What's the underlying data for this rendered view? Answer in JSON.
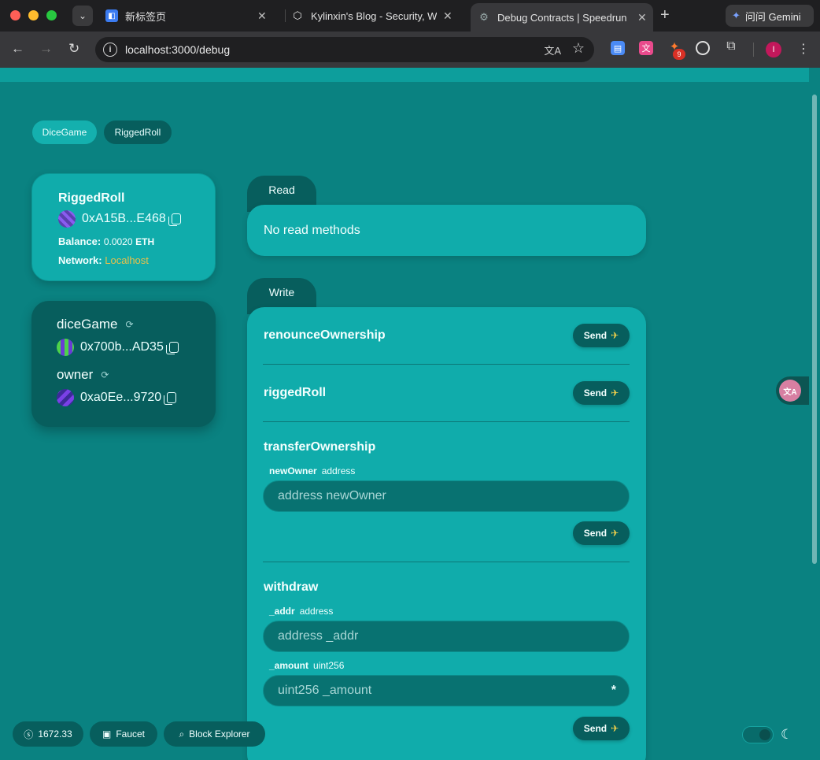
{
  "browser": {
    "tabs": [
      {
        "title": "新标签页",
        "active": false
      },
      {
        "title": "Kylinxin's Blog - Security, We",
        "active": false
      },
      {
        "title": "Debug Contracts | Speedrun",
        "active": true
      }
    ],
    "gemini_label": "问问 Gemini",
    "url": "localhost:3000/debug",
    "extension_badge": "9",
    "profile_initial": "I"
  },
  "contract_tabs": [
    "DiceGame",
    "RiggedRoll"
  ],
  "contract": {
    "name": "RiggedRoll",
    "address": "0xA15B...E468",
    "balance_label": "Balance:",
    "balance_value": "0.0020",
    "balance_unit": "ETH",
    "network_label": "Network:",
    "network_value": "Localhost"
  },
  "variables": [
    {
      "name": "diceGame",
      "address": "0x700b...AD35"
    },
    {
      "name": "owner",
      "address": "0xa0Ee...9720"
    }
  ],
  "read": {
    "tab_label": "Read",
    "empty_message": "No read methods"
  },
  "write": {
    "tab_label": "Write",
    "send_label": "Send",
    "functions": [
      {
        "name": "renounceOwnership"
      },
      {
        "name": "riggedRoll"
      },
      {
        "name": "transferOwnership",
        "params": [
          {
            "name": "newOwner",
            "type": "address",
            "placeholder": "address newOwner"
          }
        ]
      },
      {
        "name": "withdraw",
        "params": [
          {
            "name": "_addr",
            "type": "address",
            "placeholder": "address _addr"
          },
          {
            "name": "_amount",
            "type": "uint256",
            "placeholder": "uint256 _amount"
          }
        ]
      }
    ]
  },
  "footer": {
    "price": "1672.33",
    "faucet": "Faucet",
    "explorer": "Block Explorer"
  },
  "colors": {
    "page_bg": "#0a8281",
    "card_bg": "#10acab",
    "dark_card_bg": "#075e5d",
    "network_accent": "#e8c04a"
  }
}
